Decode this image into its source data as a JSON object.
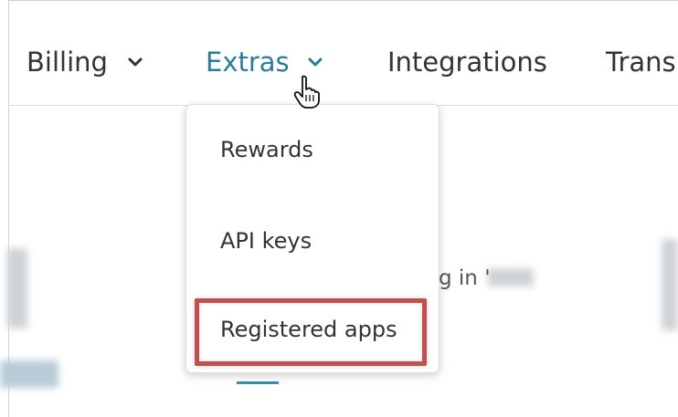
{
  "nav": {
    "items": [
      {
        "label": "Billing",
        "has_dropdown": true,
        "active": false
      },
      {
        "label": "Extras",
        "has_dropdown": true,
        "active": true
      },
      {
        "label": "Integrations",
        "has_dropdown": false,
        "active": false
      },
      {
        "label": "Trans",
        "has_dropdown": false,
        "active": false
      }
    ],
    "active_color": "#2a7c97",
    "text_color": "#333333"
  },
  "dropdown": {
    "items": [
      {
        "label": "Rewards"
      },
      {
        "label": "API keys"
      },
      {
        "label": "Registered apps",
        "highlighted": true
      }
    ]
  },
  "background": {
    "partial_text": "g in '"
  },
  "annotation": {
    "highlight_color": "#c0504d"
  },
  "icons": {
    "chevron": "chevron-down-icon",
    "cursor": "hand-pointer-icon"
  }
}
